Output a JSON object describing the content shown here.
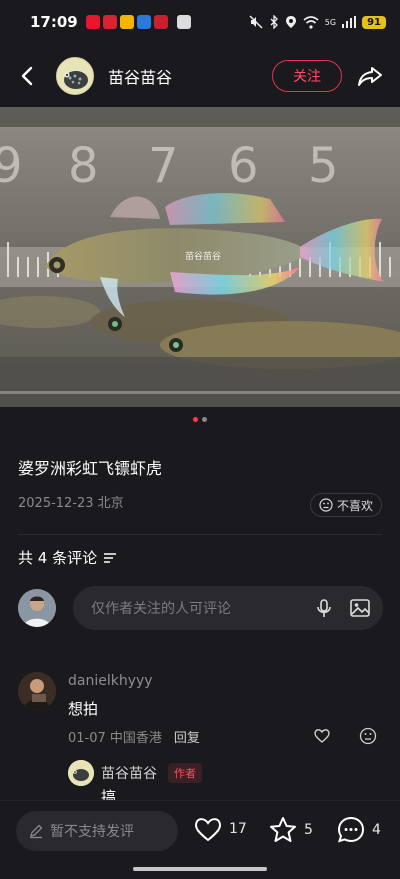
{
  "status_bar": {
    "time": "17:09",
    "signal": "5G",
    "battery": "91"
  },
  "header": {
    "author": "苗谷苗谷",
    "follow_label": "关注"
  },
  "photo": {
    "watermark": "苗谷苗谷",
    "ruler_numbers": [
      "9",
      "8",
      "7",
      "6",
      "5"
    ]
  },
  "post": {
    "title": "婆罗洲彩虹飞镖虾虎",
    "date_location": "2025-12-23 北京",
    "dislike_label": "不喜欢"
  },
  "comments_section": {
    "count_label": "共 4 条评论",
    "input_placeholder": "仅作者关注的人可评论"
  },
  "comments": [
    {
      "user": "danielkhyyy",
      "text": "想拍",
      "meta": "01-07 中国香港",
      "reply_label": "回复"
    }
  ],
  "reply": {
    "user": "苗谷苗谷",
    "badge": "作者",
    "text": "搞"
  },
  "bottom_bar": {
    "input_placeholder": "暂不支持发评",
    "likes": "17",
    "stars": "5",
    "comments": "4"
  },
  "colors": {
    "accent": "#ff3b4f",
    "background": "#1a1a1e"
  }
}
